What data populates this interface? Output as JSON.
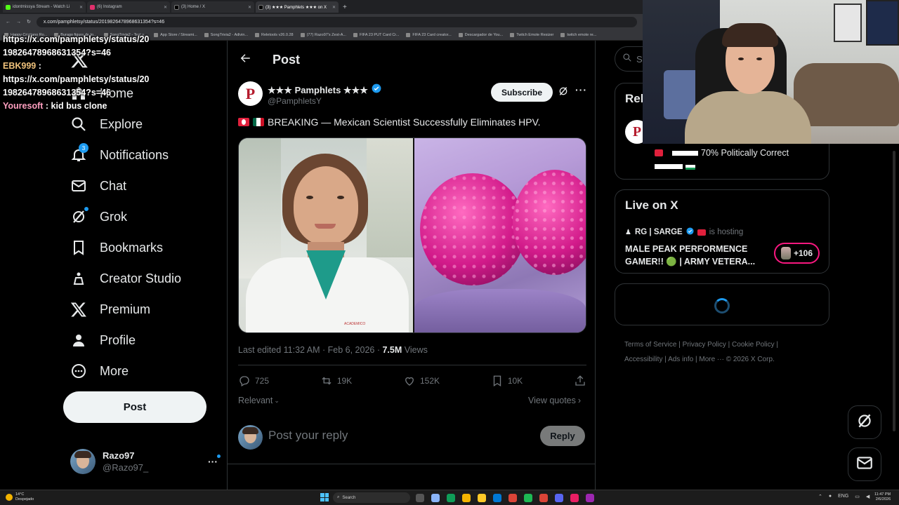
{
  "browser": {
    "tabs": [
      {
        "label": "idontmissya Stream - Watch Li",
        "color": "#53fc18"
      },
      {
        "label": "(6) Instagram",
        "color": "#e1306c"
      },
      {
        "label": "(3) Home / X",
        "color": "#ffffff"
      },
      {
        "label": "(3) ★★★ Pamphlets ★★★ on X",
        "color": "#ffffff"
      }
    ],
    "url": "x.com/pamphletsy/status/2019826478968631354?s=46",
    "bookmarks": [
      "Happy Cristiano Ro...",
      "Burago figura de to...",
      "SongTrivia2 - Test y...",
      "App Store / Streami...",
      "SongTrivia2 - Adivin...",
      "Reletools v26.0.28",
      "(77) Razo97's Zest-A...",
      "FIFA 23 PUT Card Cr...",
      "FIFA 23 Card creator...",
      "Descargador de You...",
      "Twitch Emote Resizer",
      "twitch emote re..."
    ]
  },
  "chat": [
    {
      "user": "",
      "text": "https://x.com/pamphletsy/status/20"
    },
    {
      "user": "",
      "text": "19826478968631354?s=46"
    },
    {
      "user": "EBK999",
      "text": ":"
    },
    {
      "user": "",
      "text": "https://x.com/pamphletsy/status/20"
    },
    {
      "user": "",
      "text": "19826478968631354?s=46"
    },
    {
      "user": "Youresoft",
      "text": ": kid bus clone"
    }
  ],
  "nav": {
    "items": [
      {
        "label": "Home",
        "icon": "home-icon"
      },
      {
        "label": "Explore",
        "icon": "search-icon"
      },
      {
        "label": "Notifications",
        "icon": "bell-icon",
        "badge": "3"
      },
      {
        "label": "Chat",
        "icon": "mail-icon"
      },
      {
        "label": "Grok",
        "icon": "grok-icon"
      },
      {
        "label": "Bookmarks",
        "icon": "bookmark-icon"
      },
      {
        "label": "Creator Studio",
        "icon": "creator-studio-icon"
      },
      {
        "label": "Premium",
        "icon": "x-logo-icon"
      },
      {
        "label": "Profile",
        "icon": "person-icon"
      },
      {
        "label": "More",
        "icon": "more-circle-icon"
      }
    ],
    "post_label": "Post",
    "account": {
      "name": "Razo97",
      "handle": "@Razo97_"
    }
  },
  "post": {
    "header_title": "Post",
    "author_name": "★★★ Pamphlets ★★★",
    "author_handle": "@PamphletsY",
    "avatar_letter": "P",
    "subscribe_label": "Subscribe",
    "text": "BREAKING — Mexican Scientist Successfully Eliminates HPV.",
    "meta_edited": "Last edited 11:32 AM · Feb 6, 2026 · ",
    "views_count": "7.5M",
    "views_label": " Views",
    "stats": {
      "replies": "725",
      "reposts": "19K",
      "likes": "152K",
      "bookmarks": "10K"
    },
    "sort_label": "Relevant",
    "view_quotes_label": "View quotes",
    "reply_placeholder": "Post your reply",
    "reply_button": "Reply",
    "image_text": "ACADEMICO"
  },
  "right": {
    "search_placeholder": "Se",
    "relevant_heading": "Rel",
    "relevant_avatar_letter": "P",
    "relevant_name": "70% Politically Correct",
    "live_heading": "Live on X",
    "live_host": "RG | SARGE",
    "live_hosting": "is hosting",
    "live_title": "MALE PEAK PERFORMENCE GAMER!! 🟢 | ARMY VETERA...",
    "live_count": "+106",
    "footer_links": [
      "Terms of Service",
      "Privacy Policy",
      "Cookie Policy",
      "Accessibility",
      "Ads info",
      "More ···",
      "© 2026 X Corp."
    ]
  },
  "taskbar": {
    "weather_temp": "14°C",
    "weather_desc": "Despejado",
    "search_label": "Search",
    "lang": "ENG",
    "time": "11:47 PM",
    "date": "2/6/2026"
  },
  "colors": {
    "accent": "#1d9bf0",
    "verified": "#1d9bf0",
    "live_pink": "#f91880"
  }
}
